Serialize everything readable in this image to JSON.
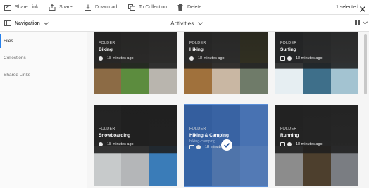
{
  "toolbar": {
    "share_link": "Share Link",
    "share": "Share",
    "download": "Download",
    "to_collection": "To Collection",
    "delete": "Delete",
    "selected_count": "1 selected"
  },
  "header": {
    "navigation": "Navigation",
    "title": "Activities"
  },
  "sidebar": {
    "items": [
      {
        "label": "Files"
      },
      {
        "label": "Collections"
      },
      {
        "label": "Shared Links"
      }
    ]
  },
  "cards": [
    {
      "kind": "FOLDER",
      "name": "Biking",
      "time": "18 minutes ago",
      "icons": [
        "globe-icon"
      ],
      "selected": false,
      "tiles": [
        "#6f6a60",
        "#8a8377",
        "#9a948b",
        "#8c6b45",
        "#5c8c3e",
        "#b9b5ae"
      ]
    },
    {
      "kind": "FOLDER",
      "name": "Hiking",
      "time": "18 minutes ago",
      "icons": [
        "globe-icon"
      ],
      "selected": false,
      "tiles": [
        "#7c7a73",
        "#9a9891",
        "#c2b53a",
        "#a0713c",
        "#c9b7a3",
        "#6f7b69"
      ]
    },
    {
      "kind": "FOLDER",
      "name": "Surfing",
      "time": "18 minutes ago",
      "icons": [
        "publish-icon",
        "globe-icon"
      ],
      "selected": false,
      "tiles": [
        "#5a6872",
        "#8d969c",
        "#b1b7bb",
        "#e6eef2",
        "#3e6f8a",
        "#a3c3d1"
      ]
    },
    {
      "kind": "FOLDER",
      "name": "Snowboarding",
      "time": "18 minutes ago",
      "icons": [
        "globe-icon"
      ],
      "selected": false,
      "tiles": [
        "#5e5e5e",
        "#2f2f2f",
        "#3a3a3a",
        "#c7cacb",
        "#b4b6b8",
        "#3a7cb8"
      ]
    },
    {
      "kind": "FOLDER",
      "name": "Hiking & Camping",
      "sub": "hiking-camping",
      "time": "18 minutes ago",
      "icons": [
        "publish-icon",
        "globe-icon"
      ],
      "selected": true,
      "tiles": [
        "#4a6a9a",
        "#5b7cae",
        "#8fb0e0",
        "#4f7db3",
        "#a9b6c6",
        "#b6cbee"
      ]
    },
    {
      "kind": "FOLDER",
      "name": "Running",
      "time": "18 minutes ago",
      "icons": [
        "publish-icon",
        "globe-icon"
      ],
      "selected": false,
      "tiles": [
        "#4c4c4c",
        "#5a5a5a",
        "#6a6a6a",
        "#8c8c8c",
        "#4d3f2d",
        "#7a7d82"
      ]
    }
  ]
}
